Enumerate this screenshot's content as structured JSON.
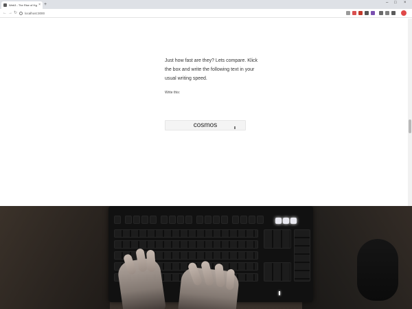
{
  "browser": {
    "tab_title": "Web3 - The Rise of Hypertext",
    "tab_close": "×",
    "new_tab": "+",
    "url": "localhost:3000",
    "window_controls": {
      "minimize": "–",
      "maximize": "□",
      "close": "×"
    },
    "nav": {
      "back": "←",
      "forward": "→",
      "reload": "↻"
    },
    "extension_colors": [
      "#8a8a8a",
      "#d94f4f",
      "#c0392b",
      "#555555",
      "#7a4fb0",
      "#6a6a6a",
      "#7f7f7f",
      "#5b5b5b"
    ],
    "profile_color": "#e04848"
  },
  "page": {
    "intro": "Just how fast are they? Lets compare. Klick the box and write the following text in your usual writing speed.",
    "write_label": "Write this:",
    "target_word": "cosmos"
  },
  "webcam": {
    "description_icons": [
      "keyboard",
      "hands",
      "mouse"
    ]
  }
}
